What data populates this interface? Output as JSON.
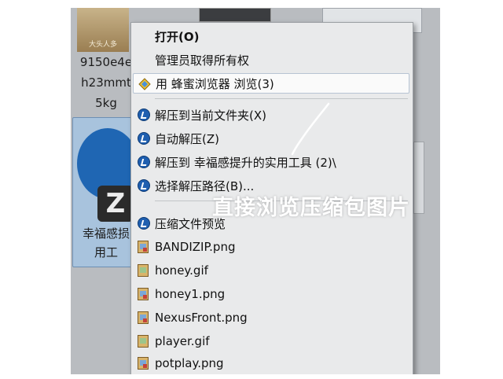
{
  "background": {
    "top_thumb_text": "大头人多",
    "file_caption_lines": [
      "9150e4e",
      "h23mmt",
      "5kg"
    ],
    "selected_file_lines": [
      "幸福感损",
      "用工"
    ],
    "zip_badge_letter": "Z"
  },
  "menu": {
    "items": [
      {
        "label": "打开(O)",
        "icon": "none",
        "bold": true
      },
      {
        "label": "管理员取得所有权",
        "icon": "none"
      },
      {
        "label": "用 蜂蜜浏览器 浏览(3)",
        "icon": "honeyview-icon",
        "hover": true
      },
      {
        "label": "解压到当前文件夹(X)",
        "icon": "bandizip-icon"
      },
      {
        "label": "自动解压(Z)",
        "icon": "bandizip-icon"
      },
      {
        "label": "解压到 幸福感提升的实用工具 (2)\\",
        "icon": "bandizip-icon"
      },
      {
        "label": "选择解压路径(B)...",
        "icon": "bandizip-icon"
      },
      {
        "label": "压缩文件预览",
        "icon": "bandizip-icon"
      },
      {
        "label": "BANDIZIP.png",
        "icon": "png-file-icon"
      },
      {
        "label": "honey.gif",
        "icon": "gif-file-icon"
      },
      {
        "label": "honey1.png",
        "icon": "png-file-icon"
      },
      {
        "label": "NexusFront.png",
        "icon": "png-file-icon"
      },
      {
        "label": "player.gif",
        "icon": "gif-file-icon"
      },
      {
        "label": "potplay.png",
        "icon": "png-file-icon"
      }
    ]
  },
  "overlay_caption": "直接浏览压缩包图片",
  "colors": {
    "dim_background": "#b9bcc0",
    "menu_background": "#e9eaeb",
    "bandizip_blue": "#1f5fb0"
  }
}
